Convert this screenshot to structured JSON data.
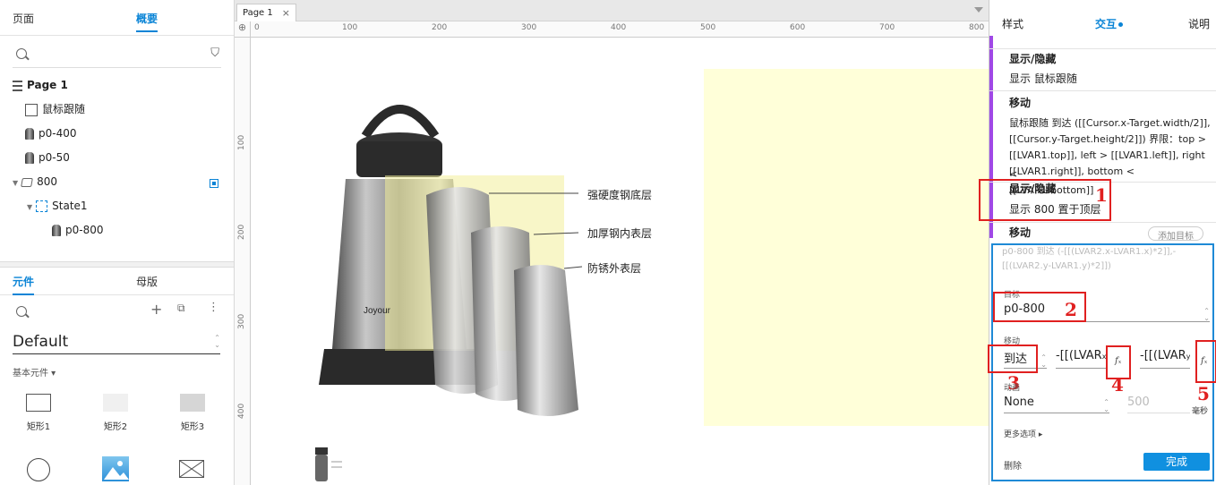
{
  "left_panel": {
    "tabs": [
      "页面",
      "概要"
    ],
    "outline": {
      "page": "Page 1",
      "items": [
        "鼠标跟随",
        "p0-400",
        "p0-50",
        "800",
        "State1",
        "p0-800"
      ]
    },
    "library_tabs": [
      "元件",
      "母版"
    ],
    "library_name": "Default",
    "section_label": "基本元件",
    "widgets": [
      "矩形1",
      "矩形2",
      "矩形3"
    ]
  },
  "canvas": {
    "tab_label": "Page 1",
    "ruler_h": [
      "0",
      "100",
      "200",
      "300",
      "400",
      "500",
      "600",
      "700",
      "800"
    ],
    "ruler_v": [
      "100",
      "200",
      "300",
      "400"
    ],
    "callouts": [
      "强硬度钢底层",
      "加厚钢内表层",
      "防锈外表层"
    ],
    "product_brand": "Joyour",
    "colors": {
      "yellow_panel": "#ffffd9"
    }
  },
  "right_panel": {
    "tabs": [
      "样式",
      "交互",
      "说明"
    ],
    "actions": [
      {
        "title": "显示/隐藏",
        "detail": "显示 鼠标跟随"
      },
      {
        "title": "移动",
        "detail_lines": [
          "鼠标跟随 到达 ([[Cursor.x-Target.width/2]],",
          "[[Cursor.y-Target.height/2]]) 界限：top >",
          "[[LVAR1.top]], left > [[LVAR1.left]], right <",
          "[[LVAR1.right]], bottom < [[LVAR1.bottom]]"
        ]
      },
      {
        "title": "显示/隐藏",
        "detail": "显示 800  置于顶层"
      }
    ],
    "editor": {
      "title": "移动",
      "add_target": "添加目标",
      "summary_lines": [
        "p0-800 到达 (-[[(LVAR2.x-LVAR1.x)*2]],-",
        "[[(LVAR2.y-LVAR1.y)*2]])"
      ],
      "target_label": "目标",
      "target_value": "p0-800",
      "move_label": "移动",
      "move_type": "到达",
      "x_value": "-[[(LVAR",
      "y_value": "-[[(LVAR",
      "x_suffix": "x",
      "y_suffix": "y",
      "anim_label": "动画",
      "anim_value": "None",
      "duration": "500",
      "duration_unit": "毫秒",
      "more_options": "更多选项",
      "delete": "删除",
      "done": "完成"
    },
    "annotations": [
      "1",
      "2",
      "3",
      "4",
      "5"
    ],
    "accent": "#0a84d6",
    "annotation_color": "#e02020"
  }
}
